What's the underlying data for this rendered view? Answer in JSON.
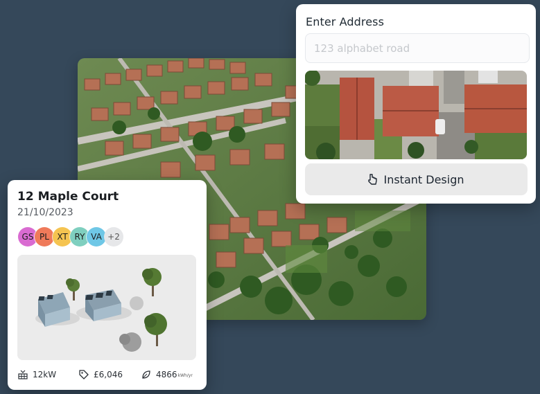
{
  "address_card": {
    "label": "Enter Address",
    "input_placeholder": "123 alphabet road",
    "input_value": "",
    "button_label": "Instant Design",
    "button_icon": "pointer-icon"
  },
  "project_card": {
    "title": "12 Maple Court",
    "date": "21/10/2023",
    "tags": [
      {
        "label": "GS",
        "color": "#d96bd1"
      },
      {
        "label": "PL",
        "color": "#ef7a5a"
      },
      {
        "label": "XT",
        "color": "#f5c451"
      },
      {
        "label": "RY",
        "color": "#7fcfbf"
      },
      {
        "label": "VA",
        "color": "#6fc7e6"
      }
    ],
    "more_tags": "+2",
    "stats": {
      "power": {
        "icon": "solar-panel-icon",
        "value": "12kW"
      },
      "price": {
        "icon": "price-tag-icon",
        "value": "£6,046"
      },
      "yield": {
        "icon": "leaf-icon",
        "value": "4866",
        "unit": "kWh/yr"
      }
    }
  }
}
